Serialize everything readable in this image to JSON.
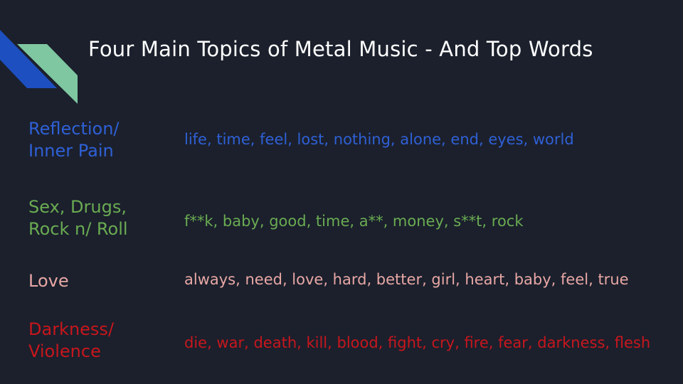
{
  "slide": {
    "title": "Four Main Topics of Metal Music - And Top Words"
  },
  "colors": {
    "background": "#1b202c",
    "title": "#ffffff",
    "decor_blue": "#1d4fc0",
    "decor_green": "#7fc7a1"
  },
  "topics": [
    {
      "label_line1": "Reflection/",
      "label_line2": "Inner Pain",
      "words": "life, time, feel, lost, nothing, alone, end, eyes, world",
      "color": "#2f60d6"
    },
    {
      "label_line1": "Sex, Drugs,",
      "label_line2": "Rock n/ Roll",
      "words": "f**k, baby, good, time, a**, money, s**t, rock",
      "color": "#6aab52"
    },
    {
      "label_line1": "Love",
      "label_line2": "",
      "words": "always, need, love, hard, better, girl, heart, baby, feel, true",
      "color": "#e8a7a5"
    },
    {
      "label_line1": "Darkness/",
      "label_line2": "Violence",
      "words": "die, war, death, kill, blood, fight, cry, fire, fear, darkness, flesh",
      "color": "#c8161d"
    }
  ]
}
